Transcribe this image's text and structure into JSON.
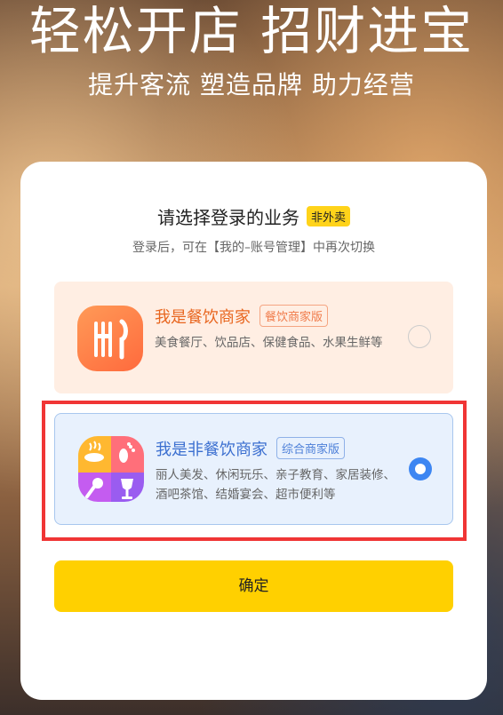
{
  "banner": {
    "headline": "轻松开店  招财进宝",
    "subline": "提升客流 塑造品牌 助力经营"
  },
  "card": {
    "title": "请选择登录的业务",
    "title_badge": "非外卖",
    "hint": "登录后，可在【我的–账号管理】中再次切换"
  },
  "options": [
    {
      "icon": "utensils-icon",
      "title": "我是餐饮商家",
      "tag": "餐饮商家版",
      "desc": "美食餐厅、饮品店、保健食品、水果生鲜等",
      "selected": false
    },
    {
      "icon": "multi-service-icon",
      "title": "我是非餐饮商家",
      "tag": "综合商家版",
      "desc": "丽人美发、休闲玩乐、亲子教育、家居装修、酒吧茶馆、结婚宴会、超市便利等",
      "selected": true
    }
  ],
  "confirm_label": "确定",
  "colors": {
    "accent_yellow": "#ffd000",
    "selected_blue": "#3d86f2",
    "food_orange": "#e8661f",
    "highlight_red": "#f03535"
  }
}
